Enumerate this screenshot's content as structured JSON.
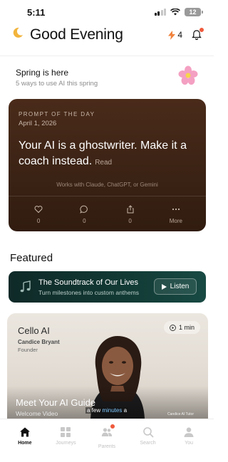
{
  "status": {
    "time": "5:11",
    "battery": "12"
  },
  "header": {
    "greeting": "Good Evening",
    "streak_count": "4",
    "moon_icon": "moon-icon",
    "bolt_icon": "bolt-icon",
    "bell_icon": "bell-icon"
  },
  "spring": {
    "title": "Spring is here",
    "subtitle": "5 ways to use AI this spring",
    "icon": "flower-icon"
  },
  "prompt": {
    "eyebrow": "PROMPT OF THE DAY",
    "date": "April 1, 2026",
    "text": "Your AI is a ghostwriter. Make it a coach instead.",
    "read_label": "Read",
    "works_with": "Works with Claude, ChatGPT, or Gemini",
    "actions": [
      {
        "icon": "heart-icon",
        "label": "0"
      },
      {
        "icon": "comment-icon",
        "label": "0"
      },
      {
        "icon": "share-icon",
        "label": "0"
      },
      {
        "icon": "more-icon",
        "label": "More"
      }
    ]
  },
  "featured": {
    "title": "Featured",
    "listen_card": {
      "title": "The Soundtrack of Our Lives",
      "subtitle": "Turn milestones into custom anthems",
      "button_label": "Listen"
    }
  },
  "video": {
    "brand": "Cello AI",
    "person": "Candice Bryant",
    "role": "Founder",
    "duration": "1 min",
    "title": "Meet Your AI Guide",
    "subtitle": "Welcome Video",
    "caption_before": "a few ",
    "caption_highlight": "minutes",
    "caption_after": " a",
    "watermark": "Candice AI Tutor"
  },
  "tabs": [
    {
      "label": "Home",
      "icon": "home-icon",
      "active": true
    },
    {
      "label": "Journeys",
      "icon": "grid-icon",
      "active": false
    },
    {
      "label": "Parents",
      "icon": "people-icon",
      "active": false
    },
    {
      "label": "Search",
      "icon": "search-icon",
      "active": false
    },
    {
      "label": "You",
      "icon": "person-icon",
      "active": false
    }
  ],
  "colors": {
    "accent": "#ef5a3c",
    "prompt_bg": "#3a2214",
    "listen_bg": "#123a35"
  }
}
